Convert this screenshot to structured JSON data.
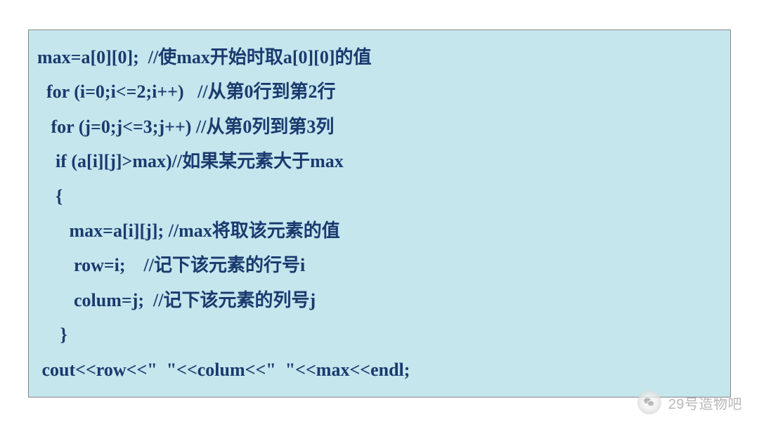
{
  "code": {
    "lines": [
      "max=a[0][0];  //使max开始时取a[0][0]的值",
      "  for (i=0;i<=2;i++)   //从第0行到第2行",
      "   for (j=0;j<=3;j++) //从第0列到第3列",
      "    if (a[i][j]>max)//如果某元素大于max",
      "    {",
      "       max=a[i][j]; //max将取该元素的值",
      "        row=i;    //记下该元素的行号i",
      "        colum=j;  //记下该元素的列号j",
      "     }",
      " cout<<row<<\"  \"<<colum<<\"  \"<<max<<endl;"
    ]
  },
  "watermark": {
    "text": "29号造物吧"
  }
}
